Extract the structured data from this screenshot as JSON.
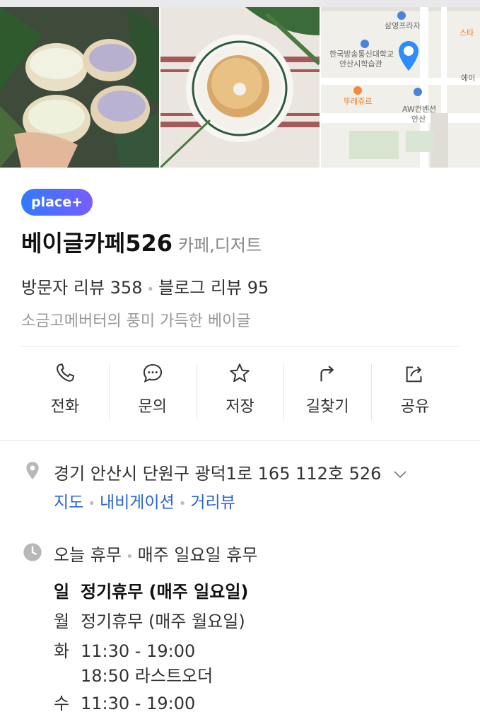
{
  "gallery": {
    "map": {
      "labels": [
        "삼영프라자",
        "스타",
        "한국방송통신대학교",
        "안산시학습관",
        "에이",
        "뚜레쥬르",
        "AW컨벤션",
        "안산"
      ]
    }
  },
  "place": {
    "badge": "place+",
    "name": "베이글카페526",
    "category": "카페,디저트",
    "visitor_reviews": "방문자 리뷰 358",
    "blog_reviews": "블로그 리뷰 95",
    "description": "소금고메버터의 풍미 가득한 베이글"
  },
  "actions": [
    {
      "label": "전화",
      "icon": "phone-icon"
    },
    {
      "label": "문의",
      "icon": "chat-icon"
    },
    {
      "label": "저장",
      "icon": "star-icon"
    },
    {
      "label": "길찾기",
      "icon": "directions-icon"
    },
    {
      "label": "공유",
      "icon": "share-icon"
    }
  ],
  "address": {
    "text": "경기 안산시 단원구 광덕1로 165 112호 526",
    "links": [
      "지도",
      "내비게이션",
      "거리뷰"
    ]
  },
  "hours": {
    "status": "오늘 휴무",
    "status_note": "매주 일요일 휴무",
    "schedule": [
      {
        "day": "일",
        "time": "정기휴무 (매주 일요일)"
      },
      {
        "day": "월",
        "time": "정기휴무 (매주 월요일)"
      },
      {
        "day": "화",
        "time": "11:30 - 19:00",
        "note": "18:50 라스트오더"
      },
      {
        "day": "수",
        "time": "11:30 - 19:00"
      }
    ]
  },
  "colors": {
    "link": "#2a66d6",
    "badge_start": "#2f7bff",
    "badge_end": "#7a5cff"
  }
}
